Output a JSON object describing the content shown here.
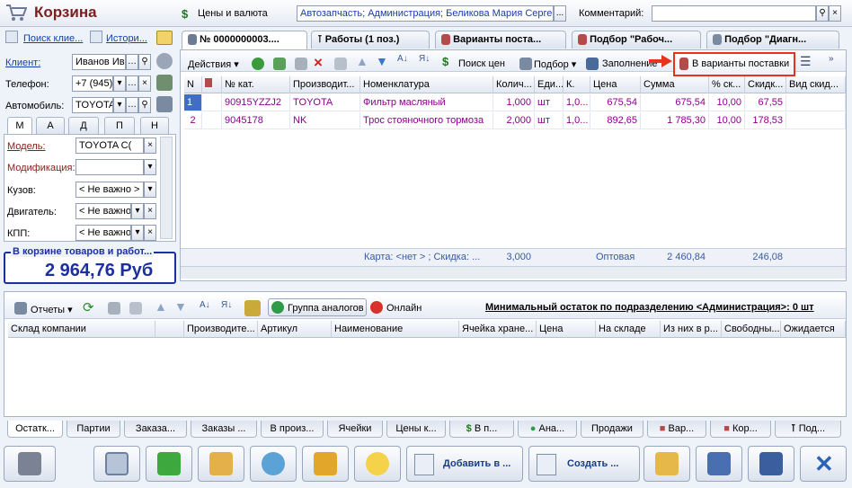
{
  "window": {
    "title": "Корзина"
  },
  "top": {
    "prices_link": "Цены и валюта",
    "context_value": "Автозапчасть; Администрация; Беликова Мария Серге",
    "context_btn": "...",
    "comment_label": "Комментарий:",
    "comment_value": ""
  },
  "left": {
    "search_link": "Поиск клие...",
    "history_link": "Истори...",
    "client_label": "Клиент:",
    "client_value": "Иванов Ив",
    "phone_label": "Телефон:",
    "phone_value": "+7 (945)",
    "car_label": "Автомобиль:",
    "car_value": "TOYOTA",
    "tabs": [
      "М",
      "А",
      "Д",
      "П",
      "Н"
    ],
    "model_label": "Модель:",
    "model_value": "TOYOTA C(",
    "mod_label": "Модификация:",
    "mod_value": "",
    "body_label": "Кузов:",
    "body_value": "< Не важно >",
    "engine_label": "Двигатель:",
    "engine_value": "< Не важно",
    "kpp_label": "КПП:",
    "kpp_value": "< Не важно",
    "total_caption": "В корзине товаров и работ...",
    "total_value": "2 964,76 Руб"
  },
  "main_tabs": [
    {
      "label": "№ 0000000003...."
    },
    {
      "label": "Работы (1 поз.)"
    },
    {
      "label": "Варианты поста..."
    },
    {
      "label": "Подбор \"Рабоч..."
    },
    {
      "label": "Подбор \"Диагн..."
    }
  ],
  "toolbar": {
    "actions": "Действия",
    "price_search": "Поиск цен",
    "pick": "Подбор",
    "fill": "Заполнение",
    "to_variants": "В варианты поставки"
  },
  "grid": {
    "columns": [
      "N",
      "",
      "№ кат.",
      "Производит...",
      "Номенклатура",
      "Колич...",
      "Еди...",
      "К.",
      "Цена",
      "Сумма",
      "% ск...",
      "Скидк...",
      "Вид скид..."
    ],
    "rows": [
      [
        "1",
        "",
        "90915YZZJ2",
        "TOYOTA",
        "Фильтр масляный",
        "1,000",
        "шт",
        "1,0...",
        "675,54",
        "675,54",
        "10,00",
        "67,55",
        ""
      ],
      [
        "2",
        "",
        "9045178",
        "NK",
        "Трос стояночного тормоза",
        "2,000",
        "шт",
        "1,0...",
        "892,65",
        "1 785,30",
        "10,00",
        "178,53",
        ""
      ]
    ],
    "footer_card": "Карта: <нет > ; Скидка: ...",
    "footer_qty": "3,000",
    "footer_type": "Оптовая",
    "footer_sum": "2 460,84",
    "footer_disc": "246,08"
  },
  "lower": {
    "reports": "Отчеты",
    "group_analogs": "Группа аналогов",
    "online": "Онлайн",
    "min_rest": "Минимальный остаток по подразделению <Администрация>: 0 шт",
    "columns": [
      "Склад компании",
      "",
      "Производите...",
      "Артикул",
      "Наименование",
      "Ячейка хране...",
      "Цена",
      "На складе",
      "Из них в р...",
      "Свободны...",
      "Ожидается"
    ]
  },
  "bottom_tabs": [
    "Остатк...",
    "Партии",
    "Заказа...",
    "Заказы ...",
    "В произ...",
    "Ячейки",
    "Цены к...",
    "В п...",
    "Ана...",
    "Продажи",
    "Вар...",
    "Кор...",
    "Под..."
  ],
  "bottom_buttons": {
    "add": "Добавить в ...",
    "create": "Создать ..."
  },
  "colors": {
    "highlight": "#e8321e",
    "total": "#1c2fa0",
    "row_text": "#8b008b",
    "title": "#7a1e1e"
  }
}
